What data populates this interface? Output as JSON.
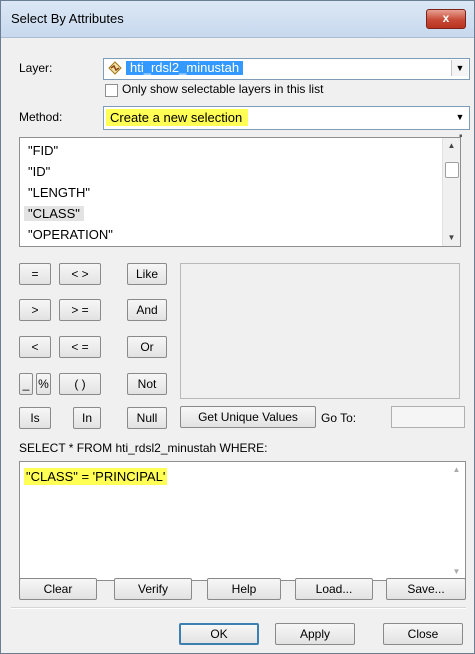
{
  "window": {
    "title": "Select By Attributes",
    "close_label": "x"
  },
  "layer": {
    "label": "Layer:",
    "value": "hti_rdsl2_minustah",
    "only_selectable_label": "Only show selectable layers in this list",
    "only_selectable_checked": false
  },
  "method": {
    "label": "Method:",
    "value": "Create a new selection"
  },
  "fields": [
    "\"FID\"",
    "\"ID\"",
    "\"LENGTH\"",
    "\"CLASS\"",
    "\"OPERATION\""
  ],
  "selected_field": "\"CLASS\"",
  "operators": {
    "eq": "=",
    "neq": "< >",
    "like": "Like",
    "gt": ">",
    "gte": "> =",
    "and": "And",
    "lt": "<",
    "lte": "< =",
    "or": "Or",
    "underscore": "_",
    "percent": "%",
    "parens": "( )",
    "not": "Not",
    "is": "Is",
    "in": "In",
    "null": "Null"
  },
  "get_unique_values_label": "Get Unique Values",
  "goto_label": "Go To:",
  "goto_value": "",
  "query_prefix": "SELECT * FROM hti_rdsl2_minustah WHERE:",
  "expression": "\"CLASS\" = 'PRINCIPAL'",
  "actions": {
    "clear": "Clear",
    "verify": "Verify",
    "help": "Help",
    "load": "Load...",
    "save": "Save..."
  },
  "footer": {
    "ok": "OK",
    "apply": "Apply",
    "close": "Close"
  },
  "colors": {
    "highlight": "#ffff55",
    "selection": "#3399ff",
    "title_close": "#c74a36"
  }
}
